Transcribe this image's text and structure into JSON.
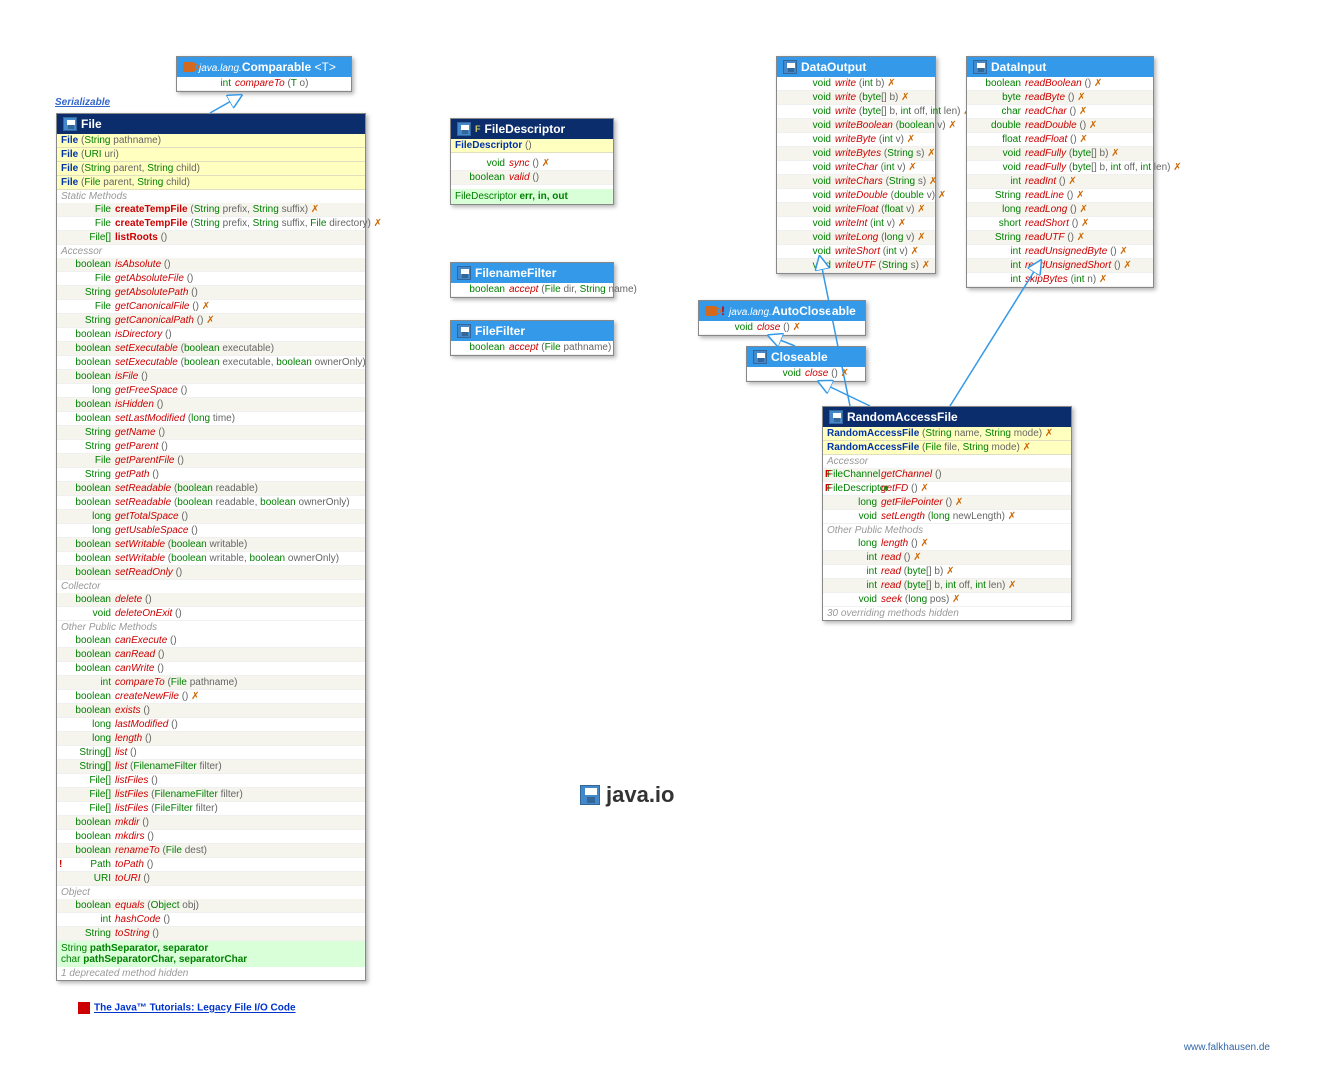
{
  "package": "java.io",
  "serializable": "Serializable",
  "tutorial_link": "The Java™ Tutorials: Legacy File I/O Code",
  "footer": "www.falkhausen.de",
  "comparable": {
    "title_pkg": "java.lang.",
    "title": "Comparable",
    "title_param": " <T>",
    "rows": [
      {
        "rt": "int",
        "nm": "compareTo",
        "pr": "(T o)"
      }
    ]
  },
  "file": {
    "title": "File",
    "ctors": [
      {
        "nm": "File",
        "pr": "(String pathname)"
      },
      {
        "nm": "File",
        "pr": "(URI uri)"
      },
      {
        "nm": "File",
        "pr": "(String parent, String child)"
      },
      {
        "nm": "File",
        "pr": "(File parent, String child)"
      }
    ],
    "secs": [
      {
        "label": "Static Methods",
        "rows": [
          {
            "rt": "File",
            "nm": "createTempFile",
            "pr": "(String prefix, String suffix)",
            "thr": true,
            "b": true
          },
          {
            "rt": "File",
            "nm": "createTempFile",
            "pr": "(String prefix, String suffix, File directory)",
            "thr": true,
            "b": true
          },
          {
            "rt": "File[]",
            "nm": "listRoots",
            "pr": "()",
            "b": true
          }
        ]
      },
      {
        "label": "Accessor",
        "rows": [
          {
            "rt": "boolean",
            "nm": "isAbsolute",
            "pr": "()"
          },
          {
            "rt": "File",
            "nm": "getAbsoluteFile",
            "pr": "()"
          },
          {
            "rt": "String",
            "nm": "getAbsolutePath",
            "pr": "()"
          },
          {
            "rt": "File",
            "nm": "getCanonicalFile",
            "pr": "()",
            "thr": true
          },
          {
            "rt": "String",
            "nm": "getCanonicalPath",
            "pr": "()",
            "thr": true
          },
          {
            "rt": "boolean",
            "nm": "isDirectory",
            "pr": "()"
          },
          {
            "rt": "boolean",
            "nm": "setExecutable",
            "pr": "(boolean executable)"
          },
          {
            "rt": "boolean",
            "nm": "setExecutable",
            "pr": "(boolean executable, boolean ownerOnly)"
          },
          {
            "rt": "boolean",
            "nm": "isFile",
            "pr": "()"
          },
          {
            "rt": "long",
            "nm": "getFreeSpace",
            "pr": "()"
          },
          {
            "rt": "boolean",
            "nm": "isHidden",
            "pr": "()"
          },
          {
            "rt": "boolean",
            "nm": "setLastModified",
            "pr": "(long time)"
          },
          {
            "rt": "String",
            "nm": "getName",
            "pr": "()"
          },
          {
            "rt": "String",
            "nm": "getParent",
            "pr": "()"
          },
          {
            "rt": "File",
            "nm": "getParentFile",
            "pr": "()"
          },
          {
            "rt": "String",
            "nm": "getPath",
            "pr": "()"
          },
          {
            "rt": "boolean",
            "nm": "setReadable",
            "pr": "(boolean readable)"
          },
          {
            "rt": "boolean",
            "nm": "setReadable",
            "pr": "(boolean readable, boolean ownerOnly)"
          },
          {
            "rt": "long",
            "nm": "getTotalSpace",
            "pr": "()"
          },
          {
            "rt": "long",
            "nm": "getUsableSpace",
            "pr": "()"
          },
          {
            "rt": "boolean",
            "nm": "setWritable",
            "pr": "(boolean writable)"
          },
          {
            "rt": "boolean",
            "nm": "setWritable",
            "pr": "(boolean writable, boolean ownerOnly)"
          },
          {
            "rt": "boolean",
            "nm": "setReadOnly",
            "pr": "()"
          }
        ]
      },
      {
        "label": "Collector",
        "rows": [
          {
            "rt": "boolean",
            "nm": "delete",
            "pr": "()"
          },
          {
            "rt": "void",
            "nm": "deleteOnExit",
            "pr": "()"
          }
        ]
      },
      {
        "label": "Other Public Methods",
        "rows": [
          {
            "rt": "boolean",
            "nm": "canExecute",
            "pr": "()"
          },
          {
            "rt": "boolean",
            "nm": "canRead",
            "pr": "()"
          },
          {
            "rt": "boolean",
            "nm": "canWrite",
            "pr": "()"
          },
          {
            "rt": "int",
            "nm": "compareTo",
            "pr": "(File pathname)"
          },
          {
            "rt": "boolean",
            "nm": "createNewFile",
            "pr": "()",
            "thr": true
          },
          {
            "rt": "boolean",
            "nm": "exists",
            "pr": "()"
          },
          {
            "rt": "long",
            "nm": "lastModified",
            "pr": "()"
          },
          {
            "rt": "long",
            "nm": "length",
            "pr": "()"
          },
          {
            "rt": "String[]",
            "nm": "list",
            "pr": "()"
          },
          {
            "rt": "String[]",
            "nm": "list",
            "pr": "(FilenameFilter filter)"
          },
          {
            "rt": "File[]",
            "nm": "listFiles",
            "pr": "()"
          },
          {
            "rt": "File[]",
            "nm": "listFiles",
            "pr": "(FilenameFilter filter)"
          },
          {
            "rt": "File[]",
            "nm": "listFiles",
            "pr": "(FileFilter filter)"
          },
          {
            "rt": "boolean",
            "nm": "mkdir",
            "pr": "()"
          },
          {
            "rt": "boolean",
            "nm": "mkdirs",
            "pr": "()"
          },
          {
            "rt": "boolean",
            "nm": "renameTo",
            "pr": "(File dest)"
          },
          {
            "rt": "Path",
            "nm": "toPath",
            "pr": "()",
            "mark": "!"
          },
          {
            "rt": "URI",
            "nm": "toURI",
            "pr": "()"
          }
        ]
      },
      {
        "label": "Object",
        "rows": [
          {
            "rt": "boolean",
            "nm": "equals",
            "pr": "(Object obj)"
          },
          {
            "rt": "int",
            "nm": "hashCode",
            "pr": "()"
          },
          {
            "rt": "String",
            "nm": "toString",
            "pr": "()"
          }
        ]
      }
    ],
    "fields": [
      {
        "rt": "String",
        "nm": "pathSeparator, separator"
      },
      {
        "rt": "char",
        "nm": "pathSeparatorChar, separatorChar"
      }
    ],
    "hidden": "1 deprecated method hidden"
  },
  "fileDescriptor": {
    "title": "FileDescriptor",
    "ctors": [
      {
        "nm": "FileDescriptor",
        "pr": "()"
      }
    ],
    "rows": [
      {
        "rt": "void",
        "nm": "sync",
        "pr": "()",
        "thr": true
      },
      {
        "rt": "boolean",
        "nm": "valid",
        "pr": "()"
      }
    ],
    "fields": [
      {
        "rt": "FileDescriptor",
        "nm": "err, in, out"
      }
    ]
  },
  "filenameFilter": {
    "title": "FilenameFilter",
    "rows": [
      {
        "rt": "boolean",
        "nm": "accept",
        "pr": "(File dir, String name)"
      }
    ]
  },
  "fileFilter": {
    "title": "FileFilter",
    "rows": [
      {
        "rt": "boolean",
        "nm": "accept",
        "pr": "(File pathname)"
      }
    ]
  },
  "dataOutput": {
    "title": "DataOutput",
    "rows": [
      {
        "rt": "void",
        "nm": "write",
        "pr": "(int b)",
        "thr": true
      },
      {
        "rt": "void",
        "nm": "write",
        "pr": "(byte[] b)",
        "thr": true
      },
      {
        "rt": "void",
        "nm": "write",
        "pr": "(byte[] b, int off, int len)",
        "thr": true
      },
      {
        "rt": "void",
        "nm": "writeBoolean",
        "pr": "(boolean v)",
        "thr": true
      },
      {
        "rt": "void",
        "nm": "writeByte",
        "pr": "(int v)",
        "thr": true
      },
      {
        "rt": "void",
        "nm": "writeBytes",
        "pr": "(String s)",
        "thr": true
      },
      {
        "rt": "void",
        "nm": "writeChar",
        "pr": "(int v)",
        "thr": true
      },
      {
        "rt": "void",
        "nm": "writeChars",
        "pr": "(String s)",
        "thr": true
      },
      {
        "rt": "void",
        "nm": "writeDouble",
        "pr": "(double v)",
        "thr": true
      },
      {
        "rt": "void",
        "nm": "writeFloat",
        "pr": "(float v)",
        "thr": true
      },
      {
        "rt": "void",
        "nm": "writeInt",
        "pr": "(int v)",
        "thr": true
      },
      {
        "rt": "void",
        "nm": "writeLong",
        "pr": "(long v)",
        "thr": true
      },
      {
        "rt": "void",
        "nm": "writeShort",
        "pr": "(int v)",
        "thr": true
      },
      {
        "rt": "void",
        "nm": "writeUTF",
        "pr": "(String s)",
        "thr": true
      }
    ]
  },
  "dataInput": {
    "title": "DataInput",
    "rows": [
      {
        "rt": "boolean",
        "nm": "readBoolean",
        "pr": "()",
        "thr": true
      },
      {
        "rt": "byte",
        "nm": "readByte",
        "pr": "()",
        "thr": true
      },
      {
        "rt": "char",
        "nm": "readChar",
        "pr": "()",
        "thr": true
      },
      {
        "rt": "double",
        "nm": "readDouble",
        "pr": "()",
        "thr": true
      },
      {
        "rt": "float",
        "nm": "readFloat",
        "pr": "()",
        "thr": true
      },
      {
        "rt": "void",
        "nm": "readFully",
        "pr": "(byte[] b)",
        "thr": true
      },
      {
        "rt": "void",
        "nm": "readFully",
        "pr": "(byte[] b, int off, int len)",
        "thr": true
      },
      {
        "rt": "int",
        "nm": "readInt",
        "pr": "()",
        "thr": true
      },
      {
        "rt": "String",
        "nm": "readLine",
        "pr": "()",
        "thr": true
      },
      {
        "rt": "long",
        "nm": "readLong",
        "pr": "()",
        "thr": true
      },
      {
        "rt": "short",
        "nm": "readShort",
        "pr": "()",
        "thr": true
      },
      {
        "rt": "String",
        "nm": "readUTF",
        "pr": "()",
        "thr": true
      },
      {
        "rt": "int",
        "nm": "readUnsignedByte",
        "pr": "()",
        "thr": true
      },
      {
        "rt": "int",
        "nm": "readUnsignedShort",
        "pr": "()",
        "thr": true
      },
      {
        "rt": "int",
        "nm": "skipBytes",
        "pr": "(int n)",
        "thr": true
      }
    ]
  },
  "autoCloseable": {
    "title_pkg": "java.lang.",
    "title": "AutoCloseable",
    "mark": "!",
    "rows": [
      {
        "rt": "void",
        "nm": "close",
        "pr": "()",
        "thr": true
      }
    ]
  },
  "closeable": {
    "title": "Closeable",
    "rows": [
      {
        "rt": "void",
        "nm": "close",
        "pr": "()",
        "thr": true
      }
    ]
  },
  "randomAccessFile": {
    "title": "RandomAccessFile",
    "ctors": [
      {
        "nm": "RandomAccessFile",
        "pr": "(String name, String mode)",
        "thr": true
      },
      {
        "nm": "RandomAccessFile",
        "pr": "(File file, String mode)",
        "thr": true
      }
    ],
    "secs": [
      {
        "label": "Accessor",
        "rows": [
          {
            "rt": "FileChannel",
            "nm": "getChannel",
            "pr": "()",
            "mark": "F"
          },
          {
            "rt": "FileDescriptor",
            "nm": "getFD",
            "pr": "()",
            "thr": true,
            "mark": "F"
          },
          {
            "rt": "long",
            "nm": "getFilePointer",
            "pr": "()",
            "thr": true
          },
          {
            "rt": "void",
            "nm": "setLength",
            "pr": "(long newLength)",
            "thr": true
          }
        ]
      },
      {
        "label": "Other Public Methods",
        "rows": [
          {
            "rt": "long",
            "nm": "length",
            "pr": "()",
            "thr": true
          },
          {
            "rt": "int",
            "nm": "read",
            "pr": "()",
            "thr": true
          },
          {
            "rt": "int",
            "nm": "read",
            "pr": "(byte[] b)",
            "thr": true
          },
          {
            "rt": "int",
            "nm": "read",
            "pr": "(byte[] b, int off, int len)",
            "thr": true
          },
          {
            "rt": "void",
            "nm": "seek",
            "pr": "(long pos)",
            "thr": true
          }
        ]
      }
    ],
    "hidden": "30 overriding methods hidden"
  }
}
